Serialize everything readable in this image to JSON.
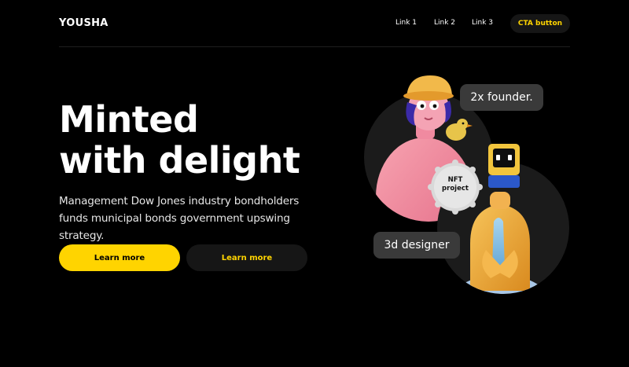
{
  "header": {
    "logo": "YOUSHA",
    "links": [
      {
        "label": "Link 1"
      },
      {
        "label": "Link 2"
      },
      {
        "label": "Link 3"
      }
    ],
    "cta_label": "CTA button"
  },
  "hero": {
    "title_line1": "Minted",
    "title_line2": "with delight",
    "description": "Management Dow Jones industry bondholders funds municipal bonds government upswing strategy.",
    "primary_button": "Learn more",
    "secondary_button": "Learn more"
  },
  "illustration": {
    "bubble_top": "2x founder.",
    "bubble_bottom": "3d designer",
    "badge_line1": "NFT",
    "badge_line2": "project"
  },
  "colors": {
    "background": "#000000",
    "accent": "#FFD400",
    "button_dark": "#161616",
    "bubble": "#3A3A3A"
  }
}
